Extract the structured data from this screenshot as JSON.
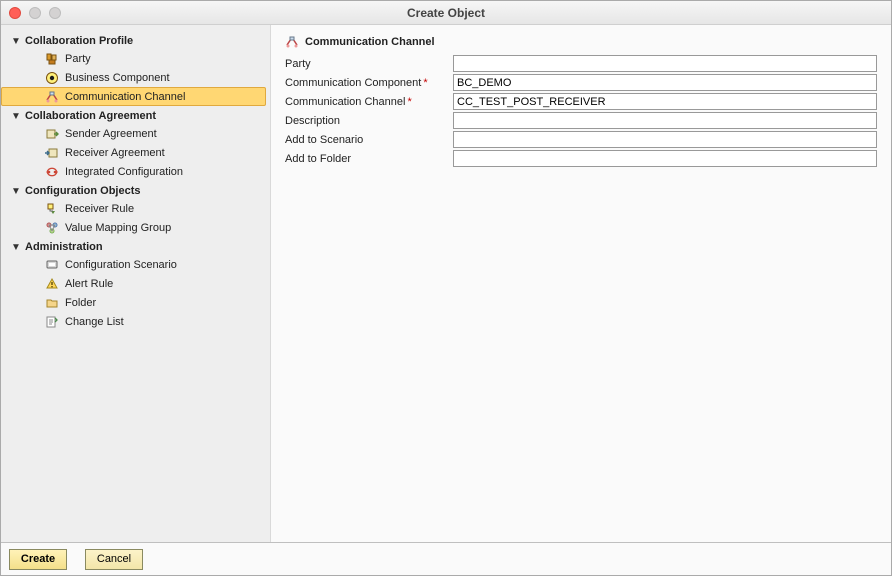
{
  "window": {
    "title": "Create Object"
  },
  "sidebar": {
    "groups": [
      {
        "label": "Collaboration Profile",
        "items": [
          {
            "label": "Party",
            "icon": "party-icon",
            "selected": false
          },
          {
            "label": "Business Component",
            "icon": "business-component-icon",
            "selected": true,
            "highlight_icon": true
          },
          {
            "label": "Communication Channel",
            "icon": "communication-channel-icon",
            "selected": false,
            "highlighted_row": true
          }
        ]
      },
      {
        "label": "Collaboration Agreement",
        "items": [
          {
            "label": "Sender Agreement",
            "icon": "sender-agreement-icon"
          },
          {
            "label": "Receiver Agreement",
            "icon": "receiver-agreement-icon"
          },
          {
            "label": "Integrated Configuration",
            "icon": "integrated-configuration-icon"
          }
        ]
      },
      {
        "label": "Configuration Objects",
        "items": [
          {
            "label": "Receiver Rule",
            "icon": "receiver-rule-icon"
          },
          {
            "label": "Value Mapping Group",
            "icon": "value-mapping-group-icon"
          }
        ]
      },
      {
        "label": "Administration",
        "items": [
          {
            "label": "Configuration Scenario",
            "icon": "configuration-scenario-icon"
          },
          {
            "label": "Alert Rule",
            "icon": "alert-rule-icon"
          },
          {
            "label": "Folder",
            "icon": "folder-icon"
          },
          {
            "label": "Change List",
            "icon": "change-list-icon"
          }
        ]
      }
    ]
  },
  "form": {
    "header": {
      "icon": "communication-channel-icon",
      "title": "Communication Channel"
    },
    "fields": {
      "party": {
        "label": "Party",
        "value": "",
        "required": false
      },
      "component": {
        "label": "Communication Component",
        "value": "BC_DEMO",
        "required": true
      },
      "channel": {
        "label": "Communication Channel",
        "value": "CC_TEST_POST_RECEIVER",
        "required": true
      },
      "description": {
        "label": "Description",
        "value": "",
        "required": false
      },
      "scenario": {
        "label": "Add to Scenario",
        "value": "",
        "required": false
      },
      "folder": {
        "label": "Add to Folder",
        "value": "",
        "required": false
      }
    }
  },
  "footer": {
    "create_label": "Create",
    "cancel_label": "Cancel"
  }
}
